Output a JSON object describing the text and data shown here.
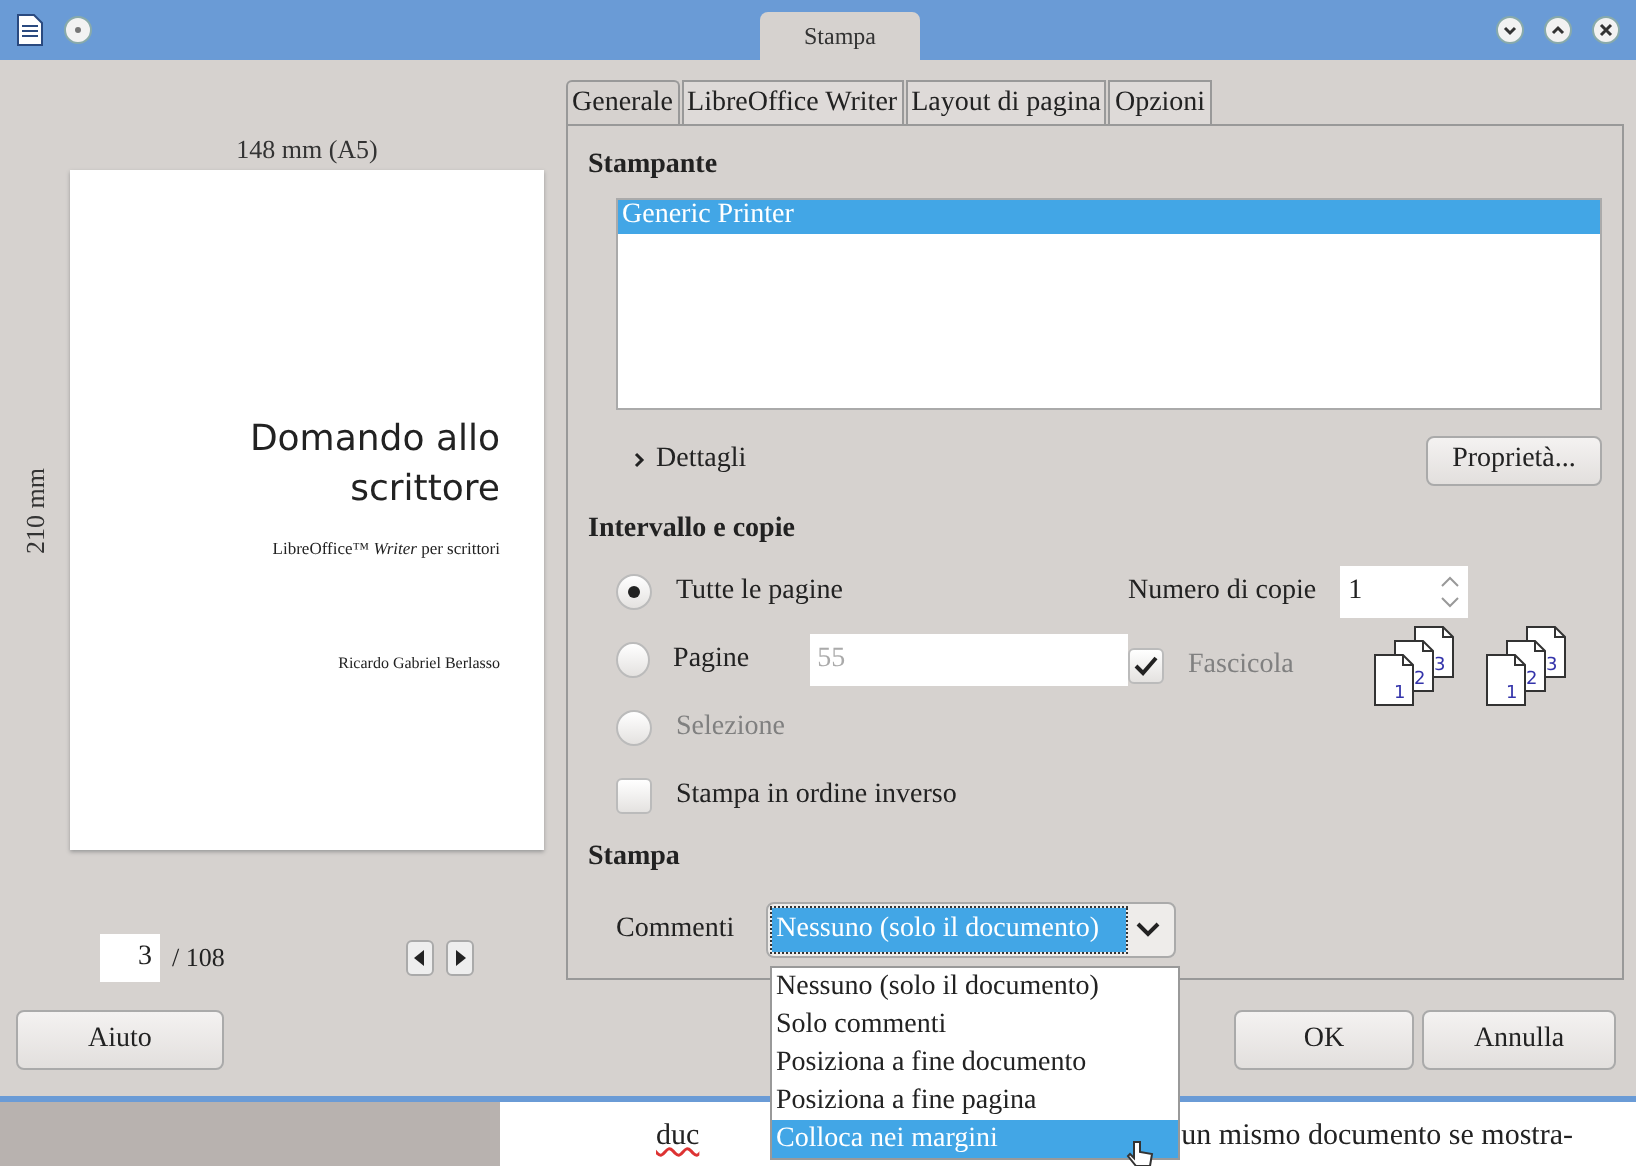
{
  "window": {
    "title": "Stampa"
  },
  "preview": {
    "width_label": "148 mm (A5)",
    "height_label": "210 mm",
    "page_title": "Domando allo scrittore",
    "page_subtitle": "LibreOffice™ *Writer* per scrittori",
    "page_author": "Ricardo Gabriel Berlasso",
    "current_page": "3",
    "total_pages": "/ 108"
  },
  "tabs": [
    {
      "label": "Generale",
      "selected": true
    },
    {
      "label": "LibreOffice Writer",
      "selected": false
    },
    {
      "label": "Layout di pagina",
      "selected": false
    },
    {
      "label": "Opzioni",
      "selected": false
    }
  ],
  "printer": {
    "heading": "Stampante",
    "items": [
      {
        "label": "Generic Printer",
        "selected": true
      }
    ],
    "details": "Dettagli",
    "details_expanded": false,
    "properties_button": "Proprietà..."
  },
  "range": {
    "heading": "Intervallo e copie",
    "options": [
      {
        "kind": "radio",
        "label": "Tutte le pagine",
        "selected": true,
        "disabled": false
      },
      {
        "kind": "radio-field",
        "label": "Pagine",
        "selected": false,
        "disabled": false,
        "value": "55",
        "field_disabled": true
      },
      {
        "kind": "radio",
        "label": "Selezione",
        "selected": false,
        "disabled": true
      },
      {
        "kind": "checkbox",
        "label": "Stampa in ordine inverso",
        "checked": false,
        "disabled": false
      }
    ],
    "copies_label": "Numero di copie",
    "copies_value": "1",
    "collate": {
      "label": "Fascicola",
      "checked": true,
      "disabled": true
    },
    "collate_previews": [
      {
        "pages": [
          "1",
          "2",
          "3"
        ]
      },
      {
        "pages": [
          "1",
          "2",
          "3"
        ]
      }
    ]
  },
  "print": {
    "heading": "Stampa",
    "comments_label": "Commenti",
    "comments_value": "Nessuno (solo il documento)",
    "dropdown_expanded": true,
    "options": [
      {
        "label": "Nessuno (solo il documento)",
        "selected": false
      },
      {
        "label": "Solo commenti",
        "selected": false
      },
      {
        "label": "Posiziona a fine documento",
        "selected": false
      },
      {
        "label": "Posiziona a fine pagina",
        "selected": false
      },
      {
        "label": "Colloca nei margini",
        "selected": true
      }
    ]
  },
  "buttons": {
    "help": "Aiuto",
    "ok": "OK",
    "cancel": "Annulla"
  },
  "background_document": {
    "text_left": "duc",
    "text_right": "un mismo documento se mostra-"
  }
}
